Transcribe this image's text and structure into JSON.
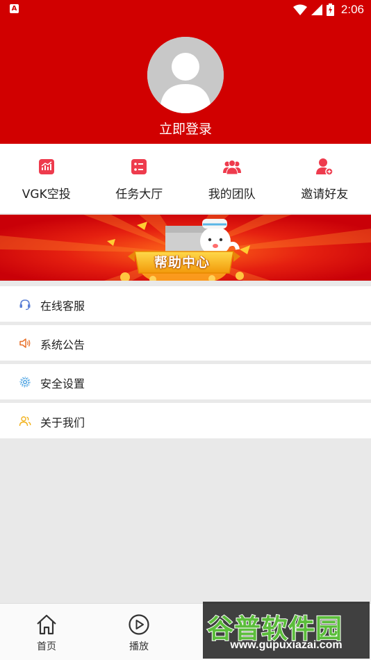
{
  "status_bar": {
    "time": "2:06"
  },
  "profile": {
    "login_label": "立即登录"
  },
  "quick_actions": [
    {
      "label": "VGK空投",
      "icon": "chart-icon"
    },
    {
      "label": "任务大厅",
      "icon": "task-list-icon"
    },
    {
      "label": "我的团队",
      "icon": "team-icon"
    },
    {
      "label": "邀请好友",
      "icon": "invite-user-icon"
    }
  ],
  "banner": {
    "label": "帮助中心"
  },
  "menu": [
    {
      "label": "在线客服",
      "icon": "headset-icon",
      "color": "#5b7fd6"
    },
    {
      "label": "系统公告",
      "icon": "speaker-icon",
      "color": "#e8702a"
    },
    {
      "label": "安全设置",
      "icon": "gear-icon",
      "color": "#3d9be0"
    },
    {
      "label": "关于我们",
      "icon": "users-icon",
      "color": "#f2b21c"
    }
  ],
  "tabs": [
    {
      "label": "首页",
      "icon": "home-icon"
    },
    {
      "label": "播放",
      "icon": "play-icon"
    }
  ],
  "watermark": {
    "title": "谷普软件园",
    "url": "www.gupuxiazai.com"
  },
  "colors": {
    "brand_red": "#d10000",
    "icon_red": "#ee3b4d"
  }
}
